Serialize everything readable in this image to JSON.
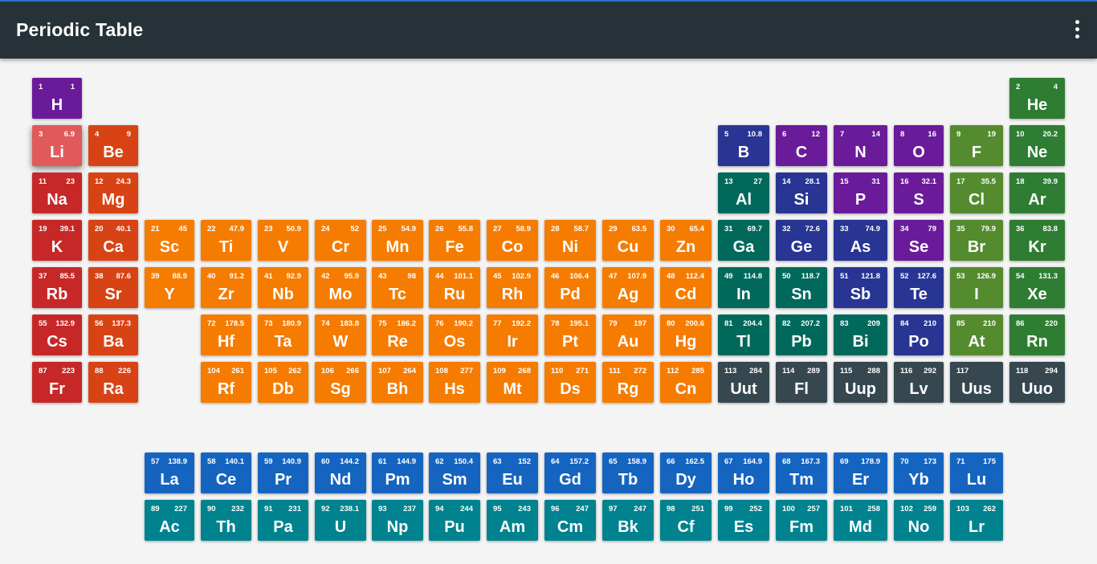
{
  "app": {
    "title": "Periodic Table",
    "menu_icon": "more-vert-icon"
  },
  "colors": {
    "alkali": "#c62828",
    "alkali_selected": "#e05a5a",
    "alkaline": "#d84315",
    "transition": "#f57c00",
    "post_transition": "#00695c",
    "metalloid": "#283593",
    "nonmetal": "#6a1b9a",
    "halogen": "#558b2f",
    "noble": "#2e7d32",
    "unknown": "#37474f",
    "lanthanide": "#1565c0",
    "actinide": "#00838f"
  },
  "elements": [
    {
      "n": "1",
      "m": "1",
      "s": "H",
      "r": 0,
      "c": 0,
      "g": "nonmetal"
    },
    {
      "n": "2",
      "m": "4",
      "s": "He",
      "r": 0,
      "c": 17,
      "g": "noble"
    },
    {
      "n": "3",
      "m": "6.9",
      "s": "Li",
      "r": 1,
      "c": 0,
      "g": "alkali_selected"
    },
    {
      "n": "4",
      "m": "9",
      "s": "Be",
      "r": 1,
      "c": 1,
      "g": "alkaline"
    },
    {
      "n": "5",
      "m": "10.8",
      "s": "B",
      "r": 1,
      "c": 12,
      "g": "metalloid"
    },
    {
      "n": "6",
      "m": "12",
      "s": "C",
      "r": 1,
      "c": 13,
      "g": "nonmetal"
    },
    {
      "n": "7",
      "m": "14",
      "s": "N",
      "r": 1,
      "c": 14,
      "g": "nonmetal"
    },
    {
      "n": "8",
      "m": "16",
      "s": "O",
      "r": 1,
      "c": 15,
      "g": "nonmetal"
    },
    {
      "n": "9",
      "m": "19",
      "s": "F",
      "r": 1,
      "c": 16,
      "g": "halogen"
    },
    {
      "n": "10",
      "m": "20.2",
      "s": "Ne",
      "r": 1,
      "c": 17,
      "g": "noble"
    },
    {
      "n": "11",
      "m": "23",
      "s": "Na",
      "r": 2,
      "c": 0,
      "g": "alkali"
    },
    {
      "n": "12",
      "m": "24.3",
      "s": "Mg",
      "r": 2,
      "c": 1,
      "g": "alkaline"
    },
    {
      "n": "13",
      "m": "27",
      "s": "Al",
      "r": 2,
      "c": 12,
      "g": "post_transition"
    },
    {
      "n": "14",
      "m": "28.1",
      "s": "Si",
      "r": 2,
      "c": 13,
      "g": "metalloid"
    },
    {
      "n": "15",
      "m": "31",
      "s": "P",
      "r": 2,
      "c": 14,
      "g": "nonmetal"
    },
    {
      "n": "16",
      "m": "32.1",
      "s": "S",
      "r": 2,
      "c": 15,
      "g": "nonmetal"
    },
    {
      "n": "17",
      "m": "35.5",
      "s": "Cl",
      "r": 2,
      "c": 16,
      "g": "halogen"
    },
    {
      "n": "18",
      "m": "39.9",
      "s": "Ar",
      "r": 2,
      "c": 17,
      "g": "noble"
    },
    {
      "n": "19",
      "m": "39.1",
      "s": "K",
      "r": 3,
      "c": 0,
      "g": "alkali"
    },
    {
      "n": "20",
      "m": "40.1",
      "s": "Ca",
      "r": 3,
      "c": 1,
      "g": "alkaline"
    },
    {
      "n": "21",
      "m": "45",
      "s": "Sc",
      "r": 3,
      "c": 2,
      "g": "transition"
    },
    {
      "n": "22",
      "m": "47.9",
      "s": "Ti",
      "r": 3,
      "c": 3,
      "g": "transition"
    },
    {
      "n": "23",
      "m": "50.9",
      "s": "V",
      "r": 3,
      "c": 4,
      "g": "transition"
    },
    {
      "n": "24",
      "m": "52",
      "s": "Cr",
      "r": 3,
      "c": 5,
      "g": "transition"
    },
    {
      "n": "25",
      "m": "54.9",
      "s": "Mn",
      "r": 3,
      "c": 6,
      "g": "transition"
    },
    {
      "n": "26",
      "m": "55.8",
      "s": "Fe",
      "r": 3,
      "c": 7,
      "g": "transition"
    },
    {
      "n": "27",
      "m": "58.9",
      "s": "Co",
      "r": 3,
      "c": 8,
      "g": "transition"
    },
    {
      "n": "28",
      "m": "58.7",
      "s": "Ni",
      "r": 3,
      "c": 9,
      "g": "transition"
    },
    {
      "n": "29",
      "m": "63.5",
      "s": "Cu",
      "r": 3,
      "c": 10,
      "g": "transition"
    },
    {
      "n": "30",
      "m": "65.4",
      "s": "Zn",
      "r": 3,
      "c": 11,
      "g": "transition"
    },
    {
      "n": "31",
      "m": "69.7",
      "s": "Ga",
      "r": 3,
      "c": 12,
      "g": "post_transition"
    },
    {
      "n": "32",
      "m": "72.6",
      "s": "Ge",
      "r": 3,
      "c": 13,
      "g": "metalloid"
    },
    {
      "n": "33",
      "m": "74.9",
      "s": "As",
      "r": 3,
      "c": 14,
      "g": "metalloid"
    },
    {
      "n": "34",
      "m": "79",
      "s": "Se",
      "r": 3,
      "c": 15,
      "g": "nonmetal"
    },
    {
      "n": "35",
      "m": "79.9",
      "s": "Br",
      "r": 3,
      "c": 16,
      "g": "halogen"
    },
    {
      "n": "36",
      "m": "83.8",
      "s": "Kr",
      "r": 3,
      "c": 17,
      "g": "noble"
    },
    {
      "n": "37",
      "m": "85.5",
      "s": "Rb",
      "r": 4,
      "c": 0,
      "g": "alkali"
    },
    {
      "n": "38",
      "m": "87.6",
      "s": "Sr",
      "r": 4,
      "c": 1,
      "g": "alkaline"
    },
    {
      "n": "39",
      "m": "88.9",
      "s": "Y",
      "r": 4,
      "c": 2,
      "g": "transition"
    },
    {
      "n": "40",
      "m": "91.2",
      "s": "Zr",
      "r": 4,
      "c": 3,
      "g": "transition"
    },
    {
      "n": "41",
      "m": "92.9",
      "s": "Nb",
      "r": 4,
      "c": 4,
      "g": "transition"
    },
    {
      "n": "42",
      "m": "95.9",
      "s": "Mo",
      "r": 4,
      "c": 5,
      "g": "transition"
    },
    {
      "n": "43",
      "m": "98",
      "s": "Tc",
      "r": 4,
      "c": 6,
      "g": "transition"
    },
    {
      "n": "44",
      "m": "101.1",
      "s": "Ru",
      "r": 4,
      "c": 7,
      "g": "transition"
    },
    {
      "n": "45",
      "m": "102.9",
      "s": "Rh",
      "r": 4,
      "c": 8,
      "g": "transition"
    },
    {
      "n": "46",
      "m": "106.4",
      "s": "Pd",
      "r": 4,
      "c": 9,
      "g": "transition"
    },
    {
      "n": "47",
      "m": "107.9",
      "s": "Ag",
      "r": 4,
      "c": 10,
      "g": "transition"
    },
    {
      "n": "48",
      "m": "112.4",
      "s": "Cd",
      "r": 4,
      "c": 11,
      "g": "transition"
    },
    {
      "n": "49",
      "m": "114.8",
      "s": "In",
      "r": 4,
      "c": 12,
      "g": "post_transition"
    },
    {
      "n": "50",
      "m": "118.7",
      "s": "Sn",
      "r": 4,
      "c": 13,
      "g": "post_transition"
    },
    {
      "n": "51",
      "m": "121.8",
      "s": "Sb",
      "r": 4,
      "c": 14,
      "g": "metalloid"
    },
    {
      "n": "52",
      "m": "127.6",
      "s": "Te",
      "r": 4,
      "c": 15,
      "g": "metalloid"
    },
    {
      "n": "53",
      "m": "126.9",
      "s": "I",
      "r": 4,
      "c": 16,
      "g": "halogen"
    },
    {
      "n": "54",
      "m": "131.3",
      "s": "Xe",
      "r": 4,
      "c": 17,
      "g": "noble"
    },
    {
      "n": "55",
      "m": "132.9",
      "s": "Cs",
      "r": 5,
      "c": 0,
      "g": "alkali"
    },
    {
      "n": "56",
      "m": "137.3",
      "s": "Ba",
      "r": 5,
      "c": 1,
      "g": "alkaline"
    },
    {
      "n": "72",
      "m": "178.5",
      "s": "Hf",
      "r": 5,
      "c": 3,
      "g": "transition"
    },
    {
      "n": "73",
      "m": "180.9",
      "s": "Ta",
      "r": 5,
      "c": 4,
      "g": "transition"
    },
    {
      "n": "74",
      "m": "183.8",
      "s": "W",
      "r": 5,
      "c": 5,
      "g": "transition"
    },
    {
      "n": "75",
      "m": "186.2",
      "s": "Re",
      "r": 5,
      "c": 6,
      "g": "transition"
    },
    {
      "n": "76",
      "m": "190.2",
      "s": "Os",
      "r": 5,
      "c": 7,
      "g": "transition"
    },
    {
      "n": "77",
      "m": "192.2",
      "s": "Ir",
      "r": 5,
      "c": 8,
      "g": "transition"
    },
    {
      "n": "78",
      "m": "195.1",
      "s": "Pt",
      "r": 5,
      "c": 9,
      "g": "transition"
    },
    {
      "n": "79",
      "m": "197",
      "s": "Au",
      "r": 5,
      "c": 10,
      "g": "transition"
    },
    {
      "n": "80",
      "m": "200.6",
      "s": "Hg",
      "r": 5,
      "c": 11,
      "g": "transition"
    },
    {
      "n": "81",
      "m": "204.4",
      "s": "Tl",
      "r": 5,
      "c": 12,
      "g": "post_transition"
    },
    {
      "n": "82",
      "m": "207.2",
      "s": "Pb",
      "r": 5,
      "c": 13,
      "g": "post_transition"
    },
    {
      "n": "83",
      "m": "209",
      "s": "Bi",
      "r": 5,
      "c": 14,
      "g": "post_transition"
    },
    {
      "n": "84",
      "m": "210",
      "s": "Po",
      "r": 5,
      "c": 15,
      "g": "metalloid"
    },
    {
      "n": "85",
      "m": "210",
      "s": "At",
      "r": 5,
      "c": 16,
      "g": "halogen"
    },
    {
      "n": "86",
      "m": "220",
      "s": "Rn",
      "r": 5,
      "c": 17,
      "g": "noble"
    },
    {
      "n": "87",
      "m": "223",
      "s": "Fr",
      "r": 6,
      "c": 0,
      "g": "alkali"
    },
    {
      "n": "88",
      "m": "226",
      "s": "Ra",
      "r": 6,
      "c": 1,
      "g": "alkaline"
    },
    {
      "n": "104",
      "m": "261",
      "s": "Rf",
      "r": 6,
      "c": 3,
      "g": "transition"
    },
    {
      "n": "105",
      "m": "262",
      "s": "Db",
      "r": 6,
      "c": 4,
      "g": "transition"
    },
    {
      "n": "106",
      "m": "266",
      "s": "Sg",
      "r": 6,
      "c": 5,
      "g": "transition"
    },
    {
      "n": "107",
      "m": "264",
      "s": "Bh",
      "r": 6,
      "c": 6,
      "g": "transition"
    },
    {
      "n": "108",
      "m": "277",
      "s": "Hs",
      "r": 6,
      "c": 7,
      "g": "transition"
    },
    {
      "n": "109",
      "m": "268",
      "s": "Mt",
      "r": 6,
      "c": 8,
      "g": "transition"
    },
    {
      "n": "110",
      "m": "271",
      "s": "Ds",
      "r": 6,
      "c": 9,
      "g": "transition"
    },
    {
      "n": "111",
      "m": "272",
      "s": "Rg",
      "r": 6,
      "c": 10,
      "g": "transition"
    },
    {
      "n": "112",
      "m": "285",
      "s": "Cn",
      "r": 6,
      "c": 11,
      "g": "transition"
    },
    {
      "n": "113",
      "m": "284",
      "s": "Uut",
      "r": 6,
      "c": 12,
      "g": "unknown"
    },
    {
      "n": "114",
      "m": "289",
      "s": "Fl",
      "r": 6,
      "c": 13,
      "g": "unknown"
    },
    {
      "n": "115",
      "m": "288",
      "s": "Uup",
      "r": 6,
      "c": 14,
      "g": "unknown"
    },
    {
      "n": "116",
      "m": "292",
      "s": "Lv",
      "r": 6,
      "c": 15,
      "g": "unknown"
    },
    {
      "n": "117",
      "m": "",
      "s": "Uus",
      "r": 6,
      "c": 16,
      "g": "unknown"
    },
    {
      "n": "118",
      "m": "294",
      "s": "Uuo",
      "r": 6,
      "c": 17,
      "g": "unknown"
    },
    {
      "n": "57",
      "m": "138.9",
      "s": "La",
      "r": 7,
      "c": 2,
      "g": "lanthanide"
    },
    {
      "n": "58",
      "m": "140.1",
      "s": "Ce",
      "r": 7,
      "c": 3,
      "g": "lanthanide"
    },
    {
      "n": "59",
      "m": "140.9",
      "s": "Pr",
      "r": 7,
      "c": 4,
      "g": "lanthanide"
    },
    {
      "n": "60",
      "m": "144.2",
      "s": "Nd",
      "r": 7,
      "c": 5,
      "g": "lanthanide"
    },
    {
      "n": "61",
      "m": "144.9",
      "s": "Pm",
      "r": 7,
      "c": 6,
      "g": "lanthanide"
    },
    {
      "n": "62",
      "m": "150.4",
      "s": "Sm",
      "r": 7,
      "c": 7,
      "g": "lanthanide"
    },
    {
      "n": "63",
      "m": "152",
      "s": "Eu",
      "r": 7,
      "c": 8,
      "g": "lanthanide"
    },
    {
      "n": "64",
      "m": "157.2",
      "s": "Gd",
      "r": 7,
      "c": 9,
      "g": "lanthanide"
    },
    {
      "n": "65",
      "m": "158.9",
      "s": "Tb",
      "r": 7,
      "c": 10,
      "g": "lanthanide"
    },
    {
      "n": "66",
      "m": "162.5",
      "s": "Dy",
      "r": 7,
      "c": 11,
      "g": "lanthanide"
    },
    {
      "n": "67",
      "m": "164.9",
      "s": "Ho",
      "r": 7,
      "c": 12,
      "g": "lanthanide"
    },
    {
      "n": "68",
      "m": "167.3",
      "s": "Tm",
      "r": 7,
      "c": 13,
      "g": "lanthanide"
    },
    {
      "n": "69",
      "m": "178.9",
      "s": "Er",
      "r": 7,
      "c": 14,
      "g": "lanthanide"
    },
    {
      "n": "70",
      "m": "173",
      "s": "Yb",
      "r": 7,
      "c": 15,
      "g": "lanthanide"
    },
    {
      "n": "71",
      "m": "175",
      "s": "Lu",
      "r": 7,
      "c": 16,
      "g": "lanthanide"
    },
    {
      "n": "89",
      "m": "227",
      "s": "Ac",
      "r": 8,
      "c": 2,
      "g": "actinide"
    },
    {
      "n": "90",
      "m": "232",
      "s": "Th",
      "r": 8,
      "c": 3,
      "g": "actinide"
    },
    {
      "n": "91",
      "m": "231",
      "s": "Pa",
      "r": 8,
      "c": 4,
      "g": "actinide"
    },
    {
      "n": "92",
      "m": "238.1",
      "s": "U",
      "r": 8,
      "c": 5,
      "g": "actinide"
    },
    {
      "n": "93",
      "m": "237",
      "s": "Np",
      "r": 8,
      "c": 6,
      "g": "actinide"
    },
    {
      "n": "94",
      "m": "244",
      "s": "Pu",
      "r": 8,
      "c": 7,
      "g": "actinide"
    },
    {
      "n": "95",
      "m": "243",
      "s": "Am",
      "r": 8,
      "c": 8,
      "g": "actinide"
    },
    {
      "n": "96",
      "m": "247",
      "s": "Cm",
      "r": 8,
      "c": 9,
      "g": "actinide"
    },
    {
      "n": "97",
      "m": "247",
      "s": "Bk",
      "r": 8,
      "c": 10,
      "g": "actinide"
    },
    {
      "n": "98",
      "m": "251",
      "s": "Cf",
      "r": 8,
      "c": 11,
      "g": "actinide"
    },
    {
      "n": "99",
      "m": "252",
      "s": "Es",
      "r": 8,
      "c": 12,
      "g": "actinide"
    },
    {
      "n": "100",
      "m": "257",
      "s": "Fm",
      "r": 8,
      "c": 13,
      "g": "actinide"
    },
    {
      "n": "101",
      "m": "258",
      "s": "Md",
      "r": 8,
      "c": 14,
      "g": "actinide"
    },
    {
      "n": "102",
      "m": "259",
      "s": "No",
      "r": 8,
      "c": 15,
      "g": "actinide"
    },
    {
      "n": "103",
      "m": "262",
      "s": "Lr",
      "r": 8,
      "c": 16,
      "g": "actinide"
    }
  ]
}
